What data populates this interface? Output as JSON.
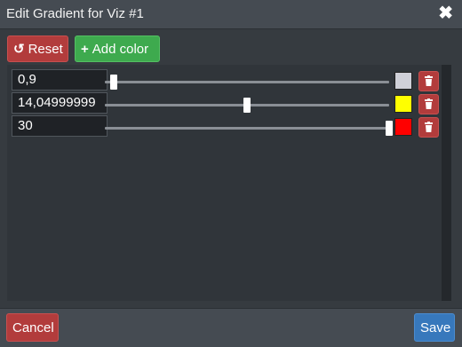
{
  "dialog": {
    "title": "Edit Gradient for Viz #1",
    "close_label": "✖"
  },
  "toolbar": {
    "reset_icon": "↺",
    "reset_label": "Reset",
    "add_icon": "+",
    "add_label": "Add color"
  },
  "stops": [
    {
      "value": "0,9",
      "position_fraction": 0.03,
      "color": "#cfd0d8"
    },
    {
      "value": "14,04999999",
      "position_fraction": 0.5,
      "color": "#ffff00"
    },
    {
      "value": "30",
      "position_fraction": 1.0,
      "color": "#ff0000"
    }
  ],
  "footer": {
    "cancel_label": "Cancel",
    "save_label": "Save"
  },
  "colors": {
    "danger": "#b23c3c",
    "success": "#3eaa4e",
    "primary": "#3778bc"
  }
}
